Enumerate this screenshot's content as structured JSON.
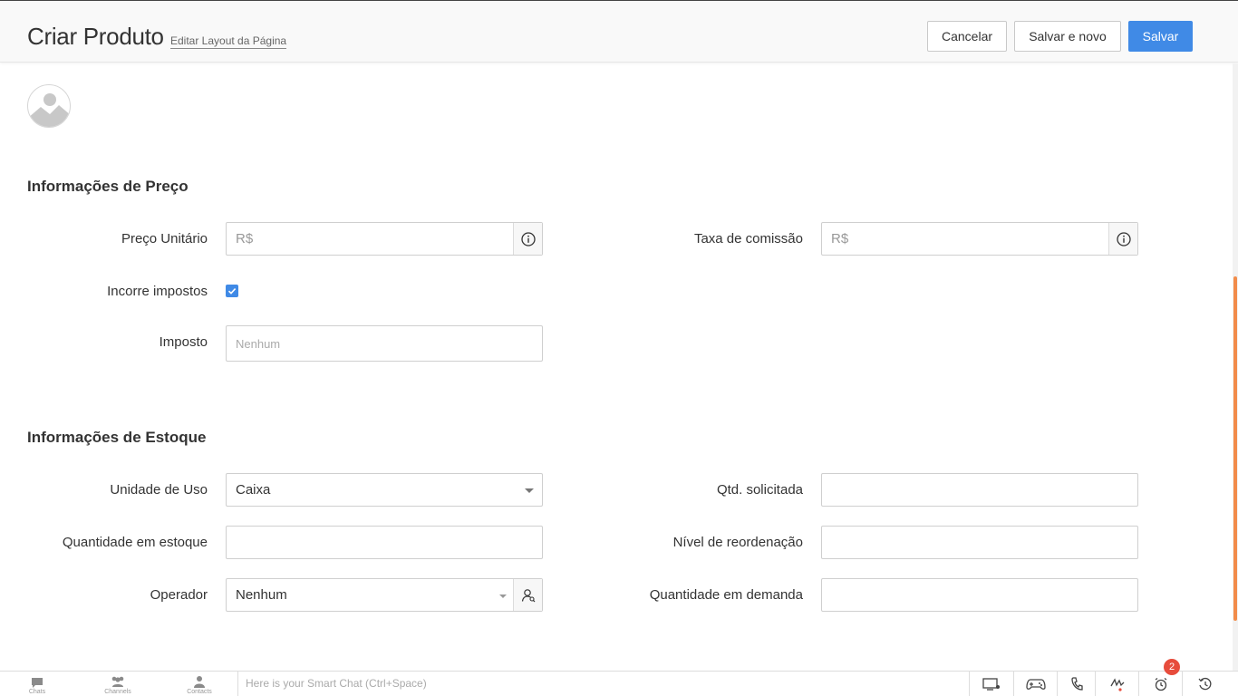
{
  "header": {
    "title": "Criar Produto",
    "layout_link": "Editar Layout da Página",
    "cancel_label": "Cancelar",
    "save_new_label": "Salvar e novo",
    "save_label": "Salvar"
  },
  "pricing": {
    "section_title": "Informações de Preço",
    "unit_price_label": "Preço Unitário",
    "unit_price_placeholder": "R$",
    "commission_label": "Taxa de comissão",
    "commission_placeholder": "R$",
    "taxable_label": "Incorre impostos",
    "taxable_checked": true,
    "tax_label": "Imposto",
    "tax_placeholder": "Nenhum"
  },
  "stock": {
    "section_title": "Informações de Estoque",
    "usage_unit_label": "Unidade de Uso",
    "usage_unit_value": "Caixa",
    "qty_ordered_label": "Qtd. solicitada",
    "qty_in_stock_label": "Quantidade em estoque",
    "reorder_level_label": "Nível de reordenação",
    "handler_label": "Operador",
    "handler_value": "Nenhum",
    "qty_in_demand_label": "Quantidade em demanda"
  },
  "bottombar": {
    "tabs": [
      "Chats",
      "Channels",
      "Contacts"
    ],
    "smart_chat_placeholder": "Here is your Smart Chat (Ctrl+Space)",
    "notification_count": "2",
    "tray_icons": [
      "screen-share-icon",
      "gamepad-icon",
      "phone-icon",
      "signature-icon",
      "alarm-icon",
      "history-icon"
    ]
  },
  "colors": {
    "primary": "#408ae6",
    "scroll_accent": "#f28c4a",
    "notification": "#e74c3c"
  }
}
